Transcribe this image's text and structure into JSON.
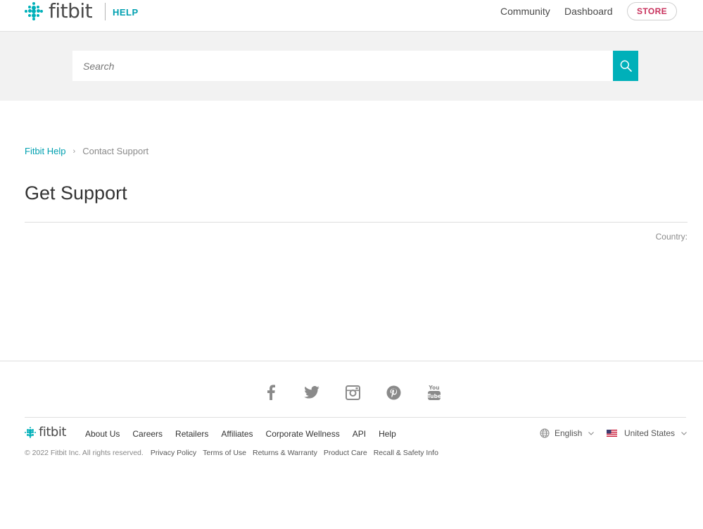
{
  "header": {
    "logo_text": "fitbit",
    "section_tag": "HELP",
    "nav": [
      "Community",
      "Dashboard"
    ],
    "store_label": "STORE"
  },
  "search": {
    "placeholder": "Search"
  },
  "breadcrumb": {
    "root": "Fitbit Help",
    "current": "Contact Support"
  },
  "page": {
    "title": "Get Support",
    "country_label": "Country:"
  },
  "footer": {
    "logo_text": "fitbit",
    "social_icons": [
      "facebook-icon",
      "twitter-icon",
      "instagram-icon",
      "pinterest-icon",
      "youtube-icon"
    ],
    "links": [
      "About Us",
      "Careers",
      "Retailers",
      "Affiliates",
      "Corporate Wellness",
      "API",
      "Help"
    ],
    "copyright": "© 2022 Fitbit Inc. All rights reserved.",
    "legal_links": [
      "Privacy Policy",
      "Terms of Use",
      "Returns & Warranty",
      "Product Care",
      "Recall & Safety Info"
    ],
    "language": "English",
    "region": "United States"
  },
  "colors": {
    "accent": "#00b0b9",
    "store": "#c8315c",
    "search_band": "#f2f2f2"
  }
}
